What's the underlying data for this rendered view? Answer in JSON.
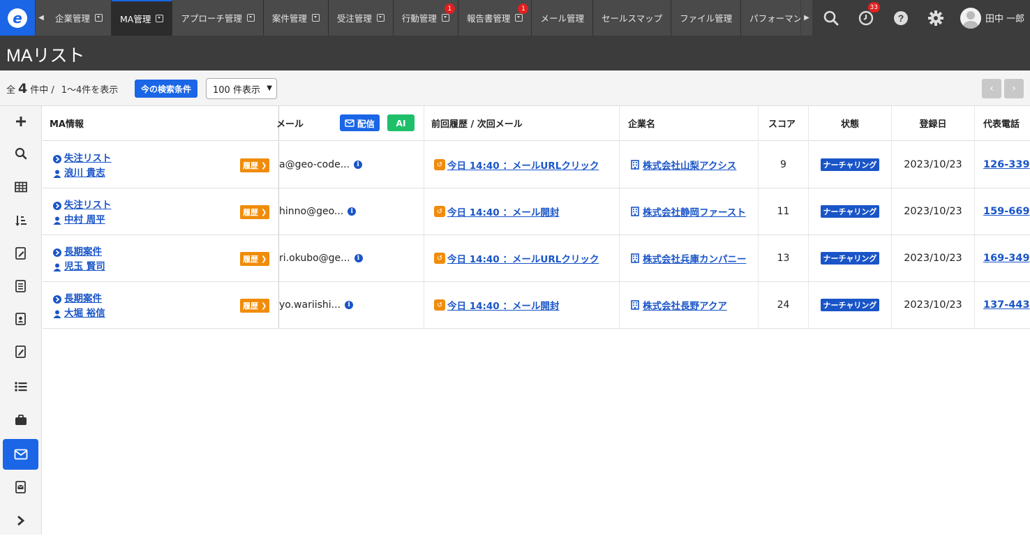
{
  "nav": {
    "tabs": [
      {
        "label": "企業管理",
        "dropdown": true
      },
      {
        "label": "MA管理",
        "dropdown": true,
        "active": true
      },
      {
        "label": "アプローチ管理",
        "dropdown": true
      },
      {
        "label": "案件管理",
        "dropdown": true
      },
      {
        "label": "受注管理",
        "dropdown": true
      },
      {
        "label": "行動管理",
        "dropdown": true,
        "badge": "1"
      },
      {
        "label": "報告書管理",
        "dropdown": true,
        "badge": "1"
      },
      {
        "label": "メール管理"
      },
      {
        "label": "セールスマップ"
      },
      {
        "label": "ファイル管理"
      },
      {
        "label": "パフォーマンス"
      }
    ],
    "history_badge": "33",
    "user_name": "田中 一郎"
  },
  "page": {
    "title": "MAリスト"
  },
  "toolbar": {
    "prefix": "全",
    "total": "4",
    "suffix": "件中 /",
    "range": "1〜4件を表示",
    "search_condition_label": "今の検索条件",
    "per_page": "100 件表示"
  },
  "columns": {
    "ma_info": "MA情報",
    "mail": "メール",
    "send_label": "配信",
    "ai_label": "AI",
    "history": "前回履歴 / 次回メール",
    "company": "企業名",
    "score": "スコア",
    "status": "状態",
    "registered": "登録日",
    "phone": "代表電話"
  },
  "rireki_label": "履歴",
  "rows": [
    {
      "list": "失注リスト",
      "person": "浪川 貴志",
      "email": "a@geo-code...",
      "history": "今日 14:40 ：メールURLクリック",
      "company": "株式会社山梨アクシス",
      "score": "9",
      "status": "ナーチャリング",
      "date": "2023/10/23",
      "phone": "126-339"
    },
    {
      "list": "失注リスト",
      "person": "中村 周平",
      "email": "hinno@geo...",
      "history": "今日 14:40 ：メール開封",
      "company": "株式会社静岡ファースト",
      "score": "11",
      "status": "ナーチャリング",
      "date": "2023/10/23",
      "phone": "159-669"
    },
    {
      "list": "長期案件",
      "person": "児玉 賢司",
      "email": "ri.okubo@ge...",
      "history": "今日 14:40 ：メールURLクリック",
      "company": "株式会社兵庫カンパニー",
      "score": "13",
      "status": "ナーチャリング",
      "date": "2023/10/23",
      "phone": "169-349"
    },
    {
      "list": "長期案件",
      "person": "大堀 裕信",
      "email": "yo.wariishi...",
      "history": "今日 14:40 ：メール開封",
      "company": "株式会社長野アクア",
      "score": "24",
      "status": "ナーチャリング",
      "date": "2023/10/23",
      "phone": "137-443"
    }
  ],
  "colors": {
    "accent": "#1a66e6",
    "orange": "#f08c0a",
    "status": "#1a55c8",
    "ai": "#1fbf6a",
    "topbar": "#3c3c3c"
  }
}
